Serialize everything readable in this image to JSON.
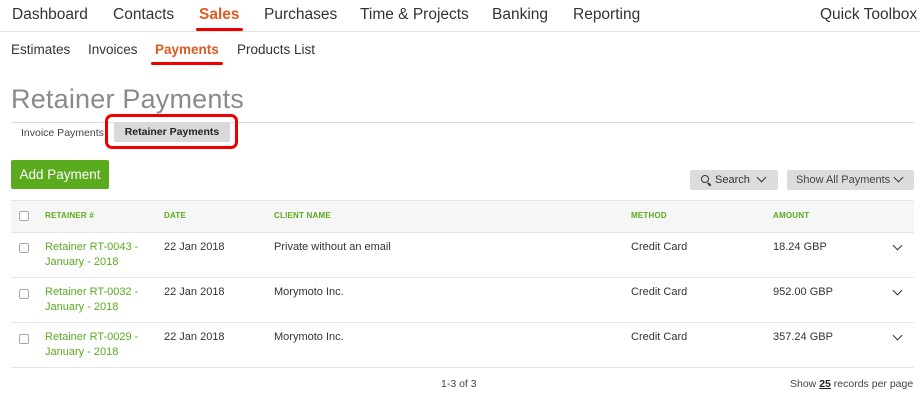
{
  "topnav": {
    "items": [
      "Dashboard",
      "Contacts",
      "Sales",
      "Purchases",
      "Time & Projects",
      "Banking",
      "Reporting"
    ],
    "active": "Sales",
    "right": "Quick Toolbox"
  },
  "subnav": {
    "items": [
      "Estimates",
      "Invoices",
      "Payments",
      "Products List"
    ],
    "active": "Payments"
  },
  "page_title": "Retainer Payments",
  "tabs": [
    "Invoice Payments",
    "Retainer Payments"
  ],
  "active_tab": "Retainer Payments",
  "buttons": {
    "add": "Add Payment",
    "search": "Search",
    "filter": "Show All Payments"
  },
  "table": {
    "headers": [
      "RETAINER #",
      "DATE",
      "CLIENT NAME",
      "METHOD",
      "AMOUNT"
    ],
    "rows": [
      {
        "retainer": "Retainer RT-0043 - January - 2018",
        "date": "22 Jan 2018",
        "client": "Private without an email",
        "method": "Credit Card",
        "amount": "18.24 GBP"
      },
      {
        "retainer": "Retainer RT-0032 - January - 2018",
        "date": "22 Jan 2018",
        "client": "Morymoto Inc.",
        "method": "Credit Card",
        "amount": "952.00 GBP"
      },
      {
        "retainer": "Retainer RT-0029 - January - 2018",
        "date": "22 Jan 2018",
        "client": "Morymoto Inc.",
        "method": "Credit Card",
        "amount": "357.24 GBP"
      }
    ]
  },
  "pagination": {
    "range": "1-3 of 3",
    "show_prefix": "Show",
    "page_size": "25",
    "show_suffix": "records per page"
  },
  "colors": {
    "accent_green": "#5aab1d",
    "active_orange": "#e05a1f",
    "highlight_red": "#e00000"
  },
  "icons": [
    "search-icon",
    "chevron-down-icon"
  ]
}
